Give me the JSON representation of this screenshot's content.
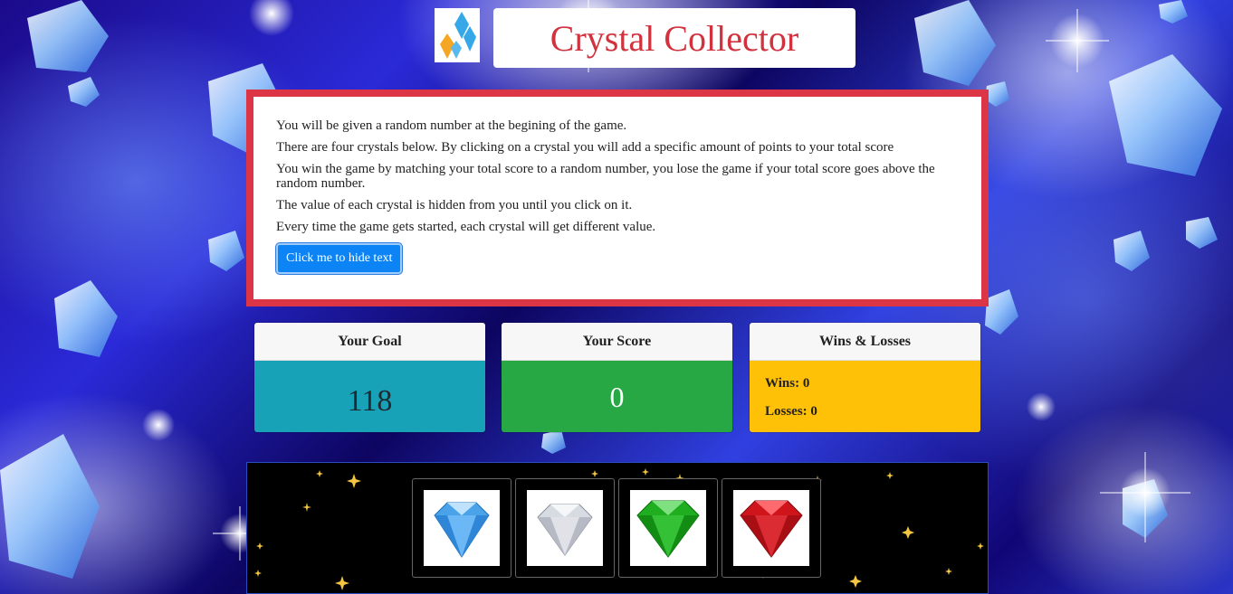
{
  "header": {
    "logo_icon": "crystal-cluster-icon",
    "title": "Crystal Collector"
  },
  "instructions": {
    "lines": [
      "You will be given a random number at the begining of the game.",
      "There are four crystals below. By clicking on a crystal you will add a specific amount of points to your total score",
      "You win the game by matching your total score to a random number, you lose the game if your total score goes above the random number.",
      "The value of each crystal is hidden from you until you click on it.",
      "Every time the game gets started, each crystal will get different value."
    ],
    "hide_button_label": "Click me to hide text"
  },
  "goal": {
    "title": "Your Goal",
    "value": "118"
  },
  "score": {
    "title": "Your Score",
    "value": "0"
  },
  "record": {
    "title": "Wins & Losses",
    "wins_label": "Wins: 0",
    "losses_label": "Losses: 0"
  },
  "crystals": [
    {
      "name": "blue-diamond-icon",
      "color": "#4aa3e8"
    },
    {
      "name": "white-diamond-icon",
      "color": "#c8ccd4"
    },
    {
      "name": "green-diamond-icon",
      "color": "#1fae1f"
    },
    {
      "name": "red-diamond-icon",
      "color": "#d0141c"
    }
  ],
  "colors": {
    "title_red": "#d1323d",
    "border_red": "#dc3545",
    "button_blue": "#0d84f5",
    "goal_teal": "#17a2b8",
    "score_green": "#28a745",
    "record_yellow": "#ffc107"
  }
}
